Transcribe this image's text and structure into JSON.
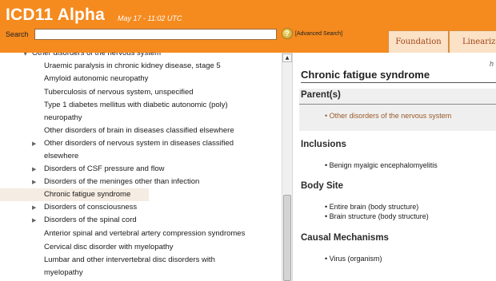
{
  "header": {
    "title": "ICD11 Alpha",
    "timestamp": "May 17 - 11:02 UTC",
    "search_label": "Search",
    "search_value": "",
    "help_glyph": "?",
    "advanced_search": "[Advanced Search]",
    "tabs": [
      {
        "label": "Foundation"
      },
      {
        "label": "Linearization"
      }
    ]
  },
  "tree": {
    "items": [
      {
        "label": "Other disorders of the nervous system",
        "expander": "down"
      },
      {
        "label": "Uraemic paralysis in chronic kidney disease, stage 5"
      },
      {
        "label": "Amyloid autonomic neuropathy"
      },
      {
        "label": "Tuberculosis of nervous system, unspecified"
      },
      {
        "label": "Type 1 diabetes mellitus with diabetic autonomic (poly)"
      },
      {
        "label": "neuropathy"
      },
      {
        "label": "Other disorders of brain in diseases classified elsewhere"
      },
      {
        "label": "Other disorders of nervous system in diseases classified",
        "expander": "right"
      },
      {
        "label": "elsewhere"
      },
      {
        "label": "Disorders of CSF pressure and flow",
        "expander": "right"
      },
      {
        "label": "Disorders of the meninges other than infection",
        "expander": "right"
      },
      {
        "label": "Chronic fatigue syndrome",
        "selected": true
      },
      {
        "label": "Disorders of consciousness",
        "expander": "right"
      },
      {
        "label": "Disorders of the spinal cord",
        "expander": "right"
      },
      {
        "label": "Anterior spinal and vertebral artery compression syndromes"
      },
      {
        "label": "Cervical disc disorder with myelopathy"
      },
      {
        "label": "Lumbar and other intervertebral disc disorders with"
      },
      {
        "label": "myelopathy"
      }
    ]
  },
  "detail": {
    "corner_text": "h",
    "title": "Chronic fatigue syndrome",
    "parents_heading": "Parent(s)",
    "parents": [
      "Other disorders of the nervous system"
    ],
    "inclusions_heading": "Inclusions",
    "inclusions": [
      "Benign myalgic encephalomyelitis"
    ],
    "body_site_heading": "Body Site",
    "body_sites": [
      "Entire brain (body structure)",
      "Brain structure (body structure)"
    ],
    "causal_heading": "Causal Mechanisms",
    "causal": [
      "Virus (organism)"
    ]
  },
  "icons": {
    "help": "help-icon",
    "expand_right": "triangle-right-icon",
    "expand_down": "triangle-down-icon",
    "scroll_up": "scroll-up-arrow-icon"
  },
  "colors": {
    "header_bg": "#f58a1f",
    "tab_text": "#a0461a",
    "parent_link": "#9a5a2a",
    "selected_row": "#f5ece3"
  }
}
